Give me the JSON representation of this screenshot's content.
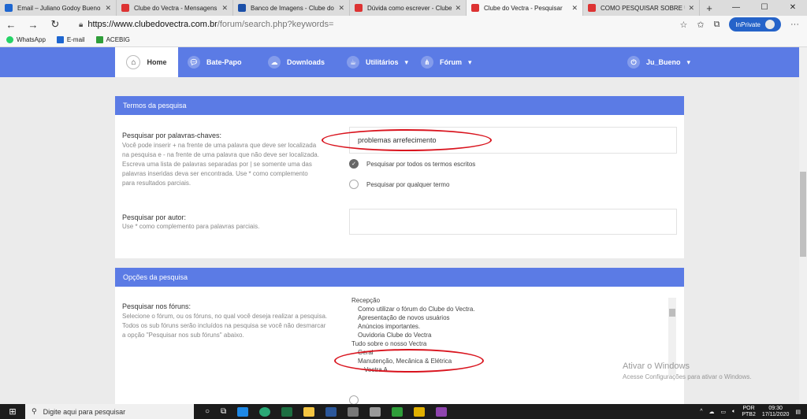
{
  "browser": {
    "tabs": [
      {
        "title": "Email – Juliano Godoy Bueno –",
        "favcolor": "#1e66d0"
      },
      {
        "title": "Clube do Vectra - Mensagens",
        "favcolor": "#d33"
      },
      {
        "title": "Banco de Imagens - Clube do",
        "favcolor": "#1b4fa8"
      },
      {
        "title": "Dúvida como escrever - Clube",
        "favcolor": "#d33"
      },
      {
        "title": "Clube do Vectra - Pesquisar",
        "favcolor": "#d33"
      },
      {
        "title": "COMO PESQUISAR SOBRE UM",
        "favcolor": "#d33"
      }
    ],
    "url_host": "https://www.clubedovectra.com.br",
    "url_path": "/forum/search.php?keywords=",
    "inprivate_label": "InPrivate",
    "bookmarks": [
      {
        "label": "WhatsApp",
        "color": "#25d366"
      },
      {
        "label": "E-mail",
        "color": "#1e66d0"
      },
      {
        "label": "ACEBIG",
        "color": "#2f9e3a"
      }
    ]
  },
  "nav": {
    "home": "Home",
    "chat": "Bate-Papo",
    "downloads": "Downloads",
    "utilities": "Utilitários",
    "forum": "Fórum",
    "user": "Ju_Bueno",
    "accent": "#5b7be5"
  },
  "search_terms": {
    "header": "Termos da pesquisa",
    "keywords_label": "Pesquisar por palavras-chaves:",
    "keywords_help": "Você pode inserir + na frente de uma palavra que deve ser localizada na pesquisa e - na frente de uma palavra que não deve ser localizada. Escreva uma lista de palavras separadas por | se somente uma das palavras inseridas deva ser encontrada. Use * como complemento para resultados parciais.",
    "keywords_value": "problemas arrefecimento",
    "radio_all": "Pesquisar por todos os termos escritos",
    "radio_any": "Pesquisar por qualquer termo",
    "author_label": "Pesquisar por autor:",
    "author_help": "Use * como complemento para palavras parciais.",
    "author_value": ""
  },
  "search_options": {
    "header": "Opções da pesquisa",
    "forums_label": "Pesquisar nos fóruns:",
    "forums_help": "Selecione o fórum, ou os fóruns, no qual você deseja realizar a pesquisa. Todos os sub fóruns serão incluídos na pesquisa se você não desmarcar a opção \"Pesquisar nos sub fóruns\" abaixo.",
    "forums": [
      {
        "name": "Recepção",
        "level": 0
      },
      {
        "name": "Como utilizar o fórum do Clube do Vectra.",
        "level": 1
      },
      {
        "name": "Apresentação de novos usuários",
        "level": 1
      },
      {
        "name": "Anúncios importantes.",
        "level": 1
      },
      {
        "name": "Ouvidoria Clube do Vectra",
        "level": 1
      },
      {
        "name": "Tudo sobre o nosso Vectra",
        "level": 0
      },
      {
        "name": "Geral",
        "level": 1
      },
      {
        "name": "Manutenção, Mecânica & Elétrica",
        "level": 1
      },
      {
        "name": "Vectra A",
        "level": 2
      }
    ]
  },
  "watermark": {
    "title": "Ativar o Windows",
    "subtitle": "Acesse Configurações para ativar o Windows."
  },
  "taskbar": {
    "search_placeholder": "Digite aqui para pesquisar",
    "lang": "POR",
    "lang_sub": "PTB2",
    "time": "09:30",
    "date": "17/11/2020"
  }
}
